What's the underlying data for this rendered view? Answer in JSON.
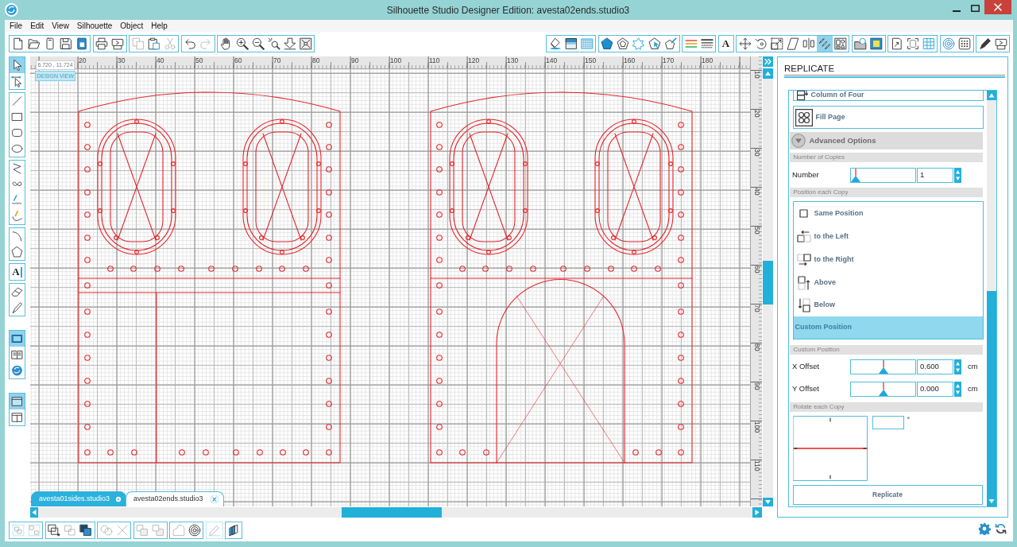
{
  "window": {
    "title": "Silhouette Studio Designer Edition: avesta02ends.studio3"
  },
  "menu": [
    "File",
    "Edit",
    "View",
    "Silhouette",
    "Object",
    "Help"
  ],
  "toolbar_left": [
    [
      {
        "disabled": false
      },
      {
        "disabled": false
      },
      {
        "disabled": false
      },
      {
        "disabled": false
      },
      {
        "disabled": false
      }
    ],
    [
      {
        "disabled": false
      },
      {
        "disabled": false
      }
    ],
    [
      {
        "disabled": true
      },
      {
        "disabled": false
      },
      {
        "disabled": true
      }
    ],
    [
      {
        "disabled": false
      },
      {
        "disabled": true
      }
    ],
    [
      {
        "disabled": false
      },
      {
        "disabled": false
      },
      {
        "disabled": false
      },
      {
        "disabled": false
      },
      {
        "disabled": false
      },
      {
        "disabled": false
      }
    ]
  ],
  "toolbar_right": [
    [
      {
        "selected": false
      },
      {
        "selected": false
      },
      {
        "selected": false
      }
    ],
    [
      {
        "selected": false
      },
      {
        "selected": false
      },
      {
        "selected": false
      },
      {
        "selected": false
      },
      {
        "selected": false
      }
    ],
    [
      {
        "selected": false
      },
      {
        "selected": false
      }
    ],
    [
      {
        "selected": false,
        "label": "A"
      }
    ],
    [
      {
        "selected": false
      },
      {
        "selected": false
      },
      {
        "selected": false
      },
      {
        "selected": false
      },
      {
        "selected": false
      },
      {
        "selected": true
      },
      {
        "selected": false
      }
    ],
    [
      {
        "selected": false
      },
      {
        "selected": false
      }
    ],
    [
      {
        "selected": false
      },
      {
        "selected": false
      },
      {
        "selected": false
      }
    ],
    [
      {
        "selected": false
      },
      {
        "selected": false
      }
    ],
    [
      {
        "selected": false
      },
      {
        "selected": false
      }
    ]
  ],
  "tools": [
    [
      {
        "selected": true
      },
      {
        "selected": false
      }
    ],
    [
      {
        "selected": false
      },
      {
        "selected": false
      },
      {
        "selected": false
      },
      {
        "selected": false
      }
    ],
    [
      {
        "selected": false
      },
      {
        "selected": false
      },
      {
        "selected": false
      },
      {
        "selected": false
      }
    ],
    [
      {
        "selected": false
      },
      {
        "selected": false
      }
    ],
    [
      {
        "selected": false,
        "label": "A"
      }
    ],
    [
      {
        "selected": false
      },
      {
        "selected": false
      }
    ],
    [
      {
        "selected": true
      },
      {
        "selected": false
      },
      {
        "selected": false
      }
    ],
    [
      {
        "selected": true
      },
      {
        "selected": false
      }
    ]
  ],
  "canvas": {
    "coordinates": "6.720 , 11.724",
    "view_label": "DESIGN VIEW",
    "top_ruler": [
      "20",
      "30",
      "40",
      "50",
      "60",
      "70",
      "80",
      "90",
      "100",
      "110",
      "120",
      "130",
      "140",
      "150",
      "160",
      "170",
      "180"
    ],
    "side_ruler": [
      "10",
      "20",
      "30",
      "40",
      "50",
      "60",
      "70",
      "80",
      "90",
      "100",
      "110"
    ]
  },
  "tabs": [
    {
      "label": "avesta01sides.studio3",
      "selected": false
    },
    {
      "label": "avesta02ends.studio3",
      "selected": true
    }
  ],
  "replicate_panel": {
    "title": "REPLICATE",
    "presets": [
      "Column of Four",
      "Fill Page"
    ],
    "advanced": {
      "label": "Advanced Options",
      "expanded": true
    },
    "copies": {
      "heading": "Number of Copies",
      "label": "Number",
      "level": 0,
      "value": "1"
    },
    "position": {
      "heading": "Position each Copy",
      "options": [
        {
          "label": "Same Position",
          "selected": false
        },
        {
          "label": "to the Left",
          "selected": false
        },
        {
          "label": "to the Right",
          "selected": false
        },
        {
          "label": "Above",
          "selected": false
        },
        {
          "label": "Below",
          "selected": false
        },
        {
          "label": "Custom Position",
          "selected": true
        }
      ]
    },
    "custom": {
      "heading": "Custom Position",
      "offsets": [
        {
          "label": "X Offset",
          "level": 0.5,
          "value": "0.600",
          "unit": "cm"
        },
        {
          "label": "Y Offset",
          "level": 0.5,
          "value": "0.000",
          "unit": "cm"
        }
      ]
    },
    "rotate": {
      "heading": "Rotate each Copy",
      "degree_sign": "°"
    },
    "button": "Replicate"
  },
  "bottom_toolbar": [
    [
      {
        "disabled": true
      },
      {
        "disabled": true
      }
    ],
    [
      {
        "disabled": false
      },
      {
        "disabled": true
      },
      {
        "disabled": false
      }
    ],
    [
      {
        "disabled": true
      },
      {
        "disabled": true
      }
    ],
    [
      {
        "disabled": true
      },
      {
        "disabled": true
      }
    ],
    [
      {
        "disabled": true
      },
      {
        "disabled": false
      }
    ],
    [
      {
        "disabled": true
      }
    ],
    [
      {
        "disabled": false
      }
    ]
  ]
}
